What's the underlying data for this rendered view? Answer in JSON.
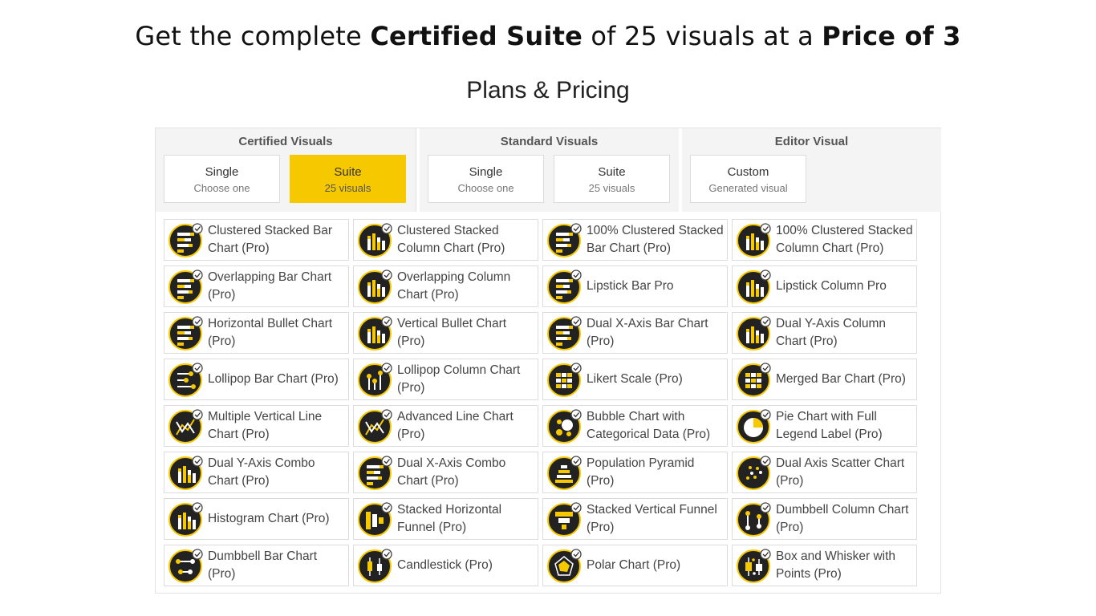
{
  "headline": {
    "part1": "Get the complete ",
    "bold1": "Certified  Suite",
    "part2": " of 25 visuals at a ",
    "bold2": "Price of 3"
  },
  "plans_title": "Plans & Pricing",
  "tabs": [
    {
      "title": "Certified Visuals",
      "options": [
        {
          "label": "Single",
          "sub": "Choose one",
          "selected": false
        },
        {
          "label": "Suite",
          "sub": "25 visuals",
          "selected": true
        }
      ]
    },
    {
      "title": "Standard Visuals",
      "options": [
        {
          "label": "Single",
          "sub": "Choose one",
          "selected": false
        },
        {
          "label": "Suite",
          "sub": "25 visuals",
          "selected": false
        }
      ]
    },
    {
      "title": "Editor Visual",
      "options": [
        {
          "label": "Custom",
          "sub": "Generated visual",
          "selected": false
        }
      ]
    }
  ],
  "colors": {
    "accent": "#f5c800",
    "icon_bg": "#222222"
  },
  "visuals": [
    {
      "label": "Clustered Stacked Bar Chart (Pro)",
      "icon": "clustered-stacked-bar-icon",
      "kind": "hbar"
    },
    {
      "label": "Clustered Stacked Column Chart (Pro)",
      "icon": "clustered-stacked-column-icon",
      "kind": "vbar"
    },
    {
      "label": "100% Clustered Stacked Bar Chart (Pro)",
      "icon": "percent-clustered-stacked-bar-icon",
      "kind": "hbar"
    },
    {
      "label": "100% Clustered Stacked Column Chart (Pro)",
      "icon": "percent-clustered-stacked-column-icon",
      "kind": "vbar"
    },
    {
      "label": "Overlapping Bar Chart (Pro)",
      "icon": "overlapping-bar-icon",
      "kind": "hbar"
    },
    {
      "label": "Overlapping Column Chart (Pro)",
      "icon": "overlapping-column-icon",
      "kind": "vbar"
    },
    {
      "label": "Lipstick Bar Pro",
      "icon": "lipstick-bar-icon",
      "kind": "hbar"
    },
    {
      "label": "Lipstick Column Pro",
      "icon": "lipstick-column-icon",
      "kind": "vbar"
    },
    {
      "label": "Horizontal Bullet Chart (Pro)",
      "icon": "horizontal-bullet-icon",
      "kind": "hbar"
    },
    {
      "label": "Vertical Bullet Chart (Pro)",
      "icon": "vertical-bullet-icon",
      "kind": "vbar"
    },
    {
      "label": "Dual X-Axis Bar Chart (Pro)",
      "icon": "dual-x-axis-bar-icon",
      "kind": "hbar"
    },
    {
      "label": "Dual Y-Axis Column Chart (Pro)",
      "icon": "dual-y-axis-column-icon",
      "kind": "vbar"
    },
    {
      "label": "Lollipop Bar Chart (Pro)",
      "icon": "lollipop-bar-icon",
      "kind": "lollih"
    },
    {
      "label": "Lollipop Column Chart (Pro)",
      "icon": "lollipop-column-icon",
      "kind": "lolliv"
    },
    {
      "label": "Likert Scale (Pro)",
      "icon": "likert-scale-icon",
      "kind": "grid"
    },
    {
      "label": "Merged Bar Chart (Pro)",
      "icon": "merged-bar-icon",
      "kind": "grid"
    },
    {
      "label": "Multiple Vertical Line Chart (Pro)",
      "icon": "multiple-vertical-line-icon",
      "kind": "line"
    },
    {
      "label": "Advanced Line Chart (Pro)",
      "icon": "advanced-line-icon",
      "kind": "line"
    },
    {
      "label": "Bubble Chart with Categorical Data (Pro)",
      "icon": "bubble-chart-icon",
      "kind": "bubble"
    },
    {
      "label": "Pie Chart with Full Legend Label (Pro)",
      "icon": "pie-chart-icon",
      "kind": "pie"
    },
    {
      "label": "Dual Y-Axis Combo Chart (Pro)",
      "icon": "dual-y-axis-combo-icon",
      "kind": "vbar"
    },
    {
      "label": "Dual X-Axis Combo Chart (Pro)",
      "icon": "dual-x-axis-combo-icon",
      "kind": "hbar"
    },
    {
      "label": "Population Pyramid (Pro)",
      "icon": "population-pyramid-icon",
      "kind": "pyramid"
    },
    {
      "label": "Dual Axis Scatter Chart (Pro)",
      "icon": "dual-axis-scatter-icon",
      "kind": "scatter"
    },
    {
      "label": "Histogram Chart (Pro)",
      "icon": "histogram-icon",
      "kind": "vbar"
    },
    {
      "label": "Stacked Horizontal Funnel (Pro)",
      "icon": "stacked-horizontal-funnel-icon",
      "kind": "hfunnel"
    },
    {
      "label": "Stacked Vertical Funnel (Pro)",
      "icon": "stacked-vertical-funnel-icon",
      "kind": "vfunnel"
    },
    {
      "label": "Dumbbell Column Chart (Pro)",
      "icon": "dumbbell-column-icon",
      "kind": "dumbv"
    },
    {
      "label": "Dumbbell Bar Chart (Pro)",
      "icon": "dumbbell-bar-icon",
      "kind": "dumbh"
    },
    {
      "label": "Candlestick (Pro)",
      "icon": "candlestick-icon",
      "kind": "candle"
    },
    {
      "label": "Polar Chart (Pro)",
      "icon": "polar-chart-icon",
      "kind": "polar"
    },
    {
      "label": "Box and Whisker with Points (Pro)",
      "icon": "box-whisker-icon",
      "kind": "box"
    }
  ]
}
